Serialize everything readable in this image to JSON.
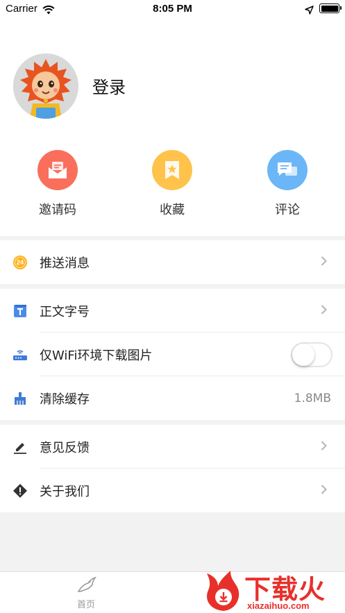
{
  "status_bar": {
    "carrier": "Carrier",
    "time": "8:05 PM"
  },
  "profile": {
    "login_label": "登录"
  },
  "shortcuts": [
    {
      "label": "邀请码",
      "icon": "envelope-icon",
      "color": "#f96f5c"
    },
    {
      "label": "收藏",
      "icon": "bookmark-star-icon",
      "color": "#ffc24b"
    },
    {
      "label": "评论",
      "icon": "chat-bubbles-icon",
      "color": "#6bb6f6"
    }
  ],
  "menu": {
    "push": {
      "label": "推送消息",
      "icon": "push-24-icon",
      "badge": "24"
    },
    "font_size": {
      "label": "正文字号",
      "icon": "text-size-icon"
    },
    "wifi_images": {
      "label": "仅WiFi环境下载图片",
      "icon": "router-icon",
      "toggle_on": false
    },
    "clear_cache": {
      "label": "清除缓存",
      "icon": "broom-icon",
      "value": "1.8MB"
    },
    "feedback": {
      "label": "意见反馈",
      "icon": "pencil-icon"
    },
    "about": {
      "label": "关于我们",
      "icon": "warning-diamond-icon"
    }
  },
  "tabbar": {
    "home_label": "首页"
  },
  "watermark": {
    "title": "下载火",
    "url": "xiazaihuo.com"
  },
  "colors": {
    "accent_red": "#e8302b",
    "push_badge": "#ffb31a",
    "font_icon": "#4a8ce8",
    "wifi_icon": "#3f7ad8"
  }
}
